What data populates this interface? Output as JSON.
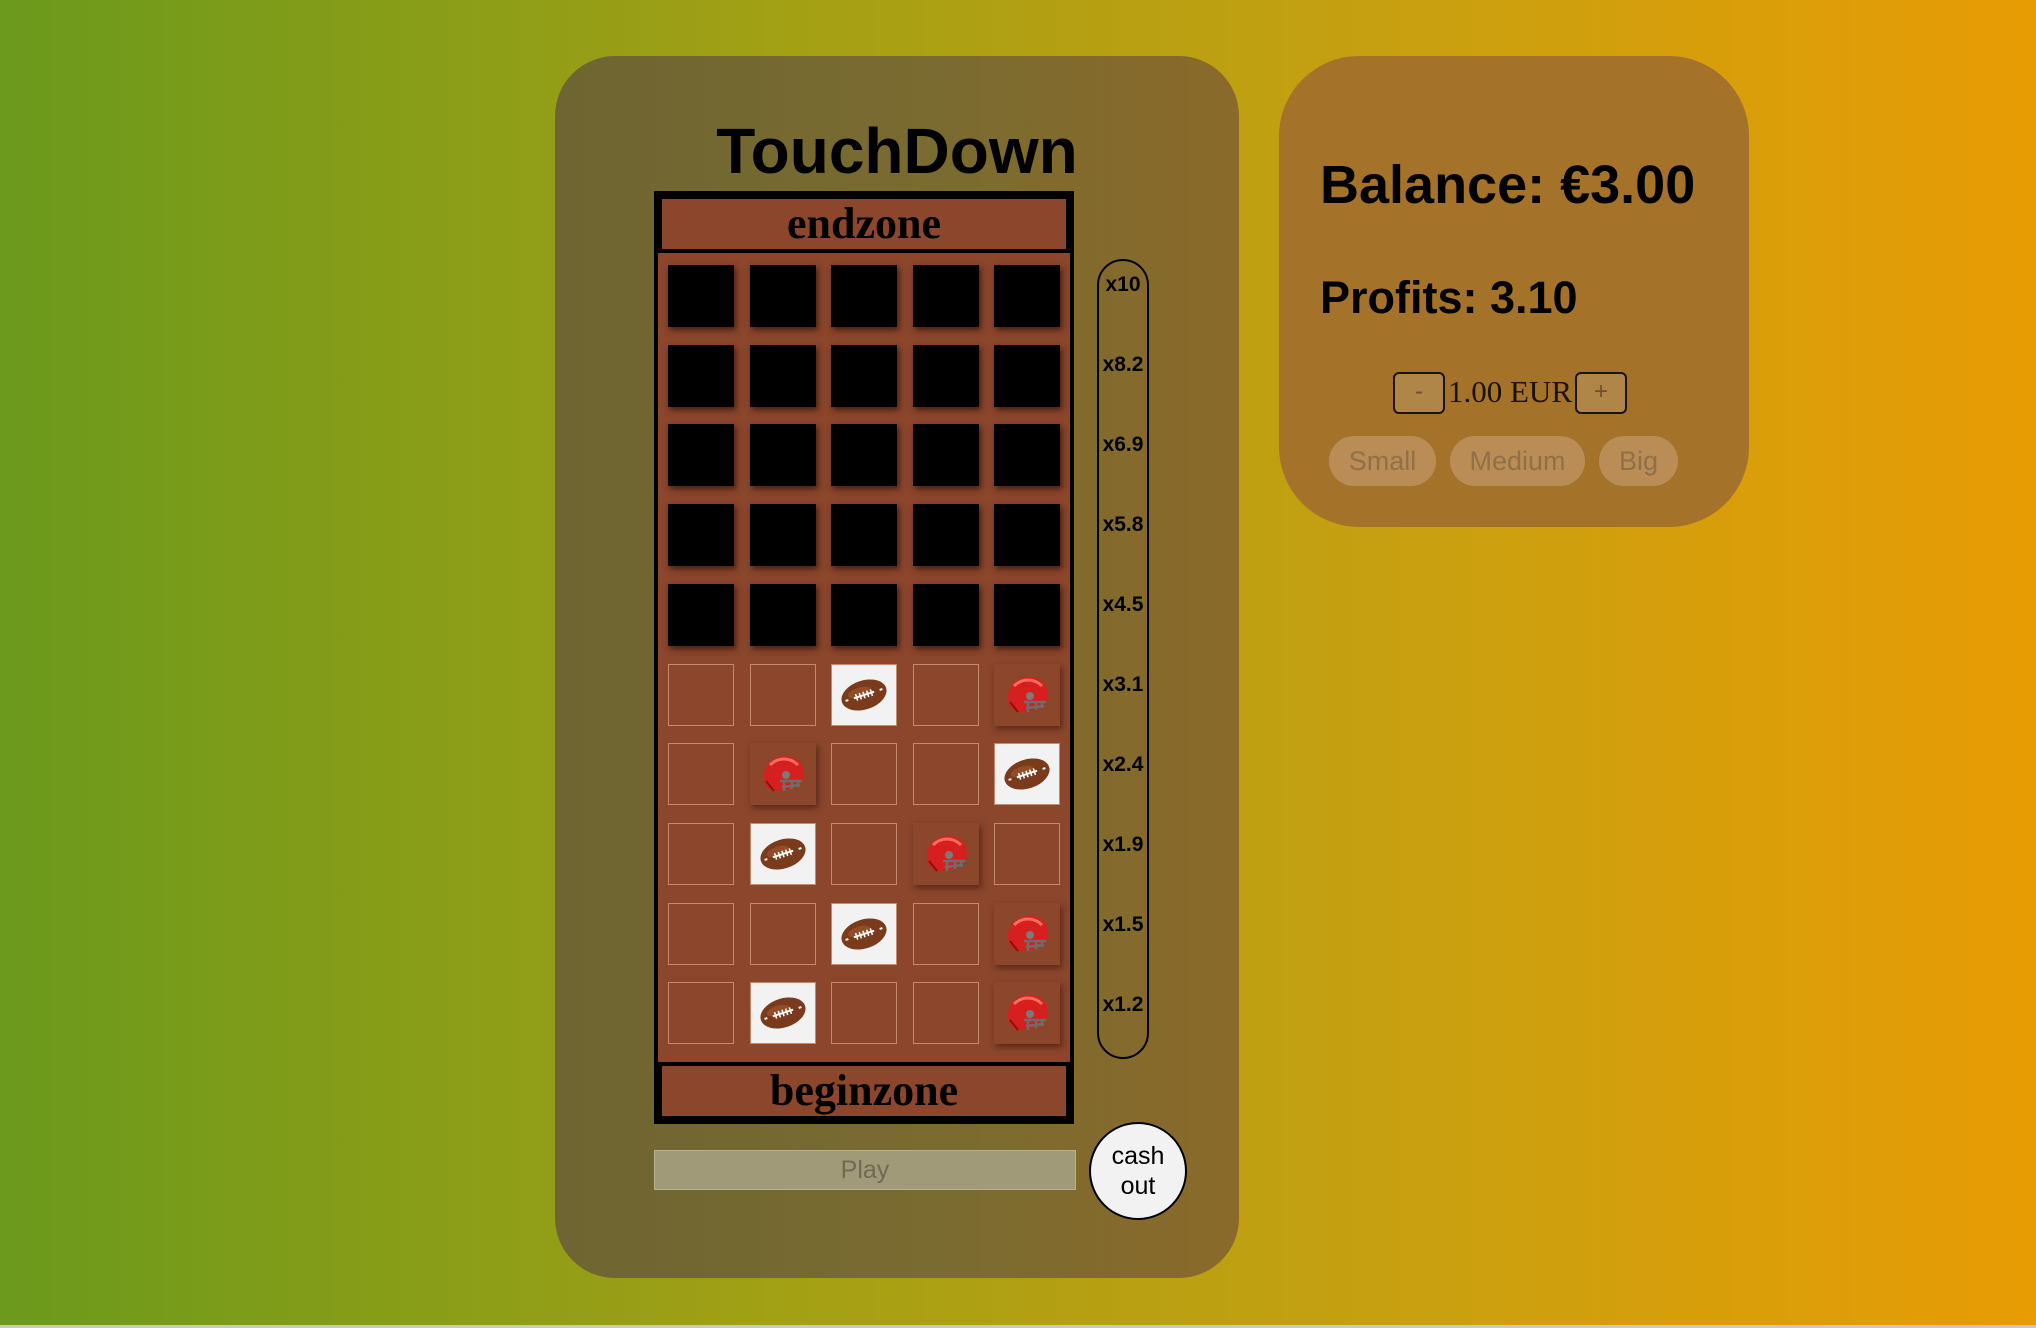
{
  "game": {
    "title": "TouchDown",
    "endzone_label": "endzone",
    "beginzone_label": "beginzone",
    "multipliers": [
      "x10",
      "x8.2",
      "x6.9",
      "x5.8",
      "x4.5",
      "x3.1",
      "x2.4",
      "x1.9",
      "x1.5",
      "x1.2"
    ],
    "board_rows_top_to_bottom": [
      [
        "hidden",
        "hidden",
        "hidden",
        "hidden",
        "hidden"
      ],
      [
        "hidden",
        "hidden",
        "hidden",
        "hidden",
        "hidden"
      ],
      [
        "hidden",
        "hidden",
        "hidden",
        "hidden",
        "hidden"
      ],
      [
        "hidden",
        "hidden",
        "hidden",
        "hidden",
        "hidden"
      ],
      [
        "hidden",
        "hidden",
        "hidden",
        "hidden",
        "hidden"
      ],
      [
        "empty",
        "empty",
        "football",
        "empty",
        "helmet"
      ],
      [
        "empty",
        "helmet",
        "empty",
        "empty",
        "football"
      ],
      [
        "empty",
        "football",
        "empty",
        "helmet",
        "empty"
      ],
      [
        "empty",
        "empty",
        "football",
        "empty",
        "helmet"
      ],
      [
        "empty",
        "football",
        "empty",
        "empty",
        "helmet"
      ]
    ],
    "play_label": "Play",
    "cashout_label": "cash out"
  },
  "wallet": {
    "balance_text": "Balance: €3.00",
    "profits_text": "Profits: 3.10",
    "minus_label": "-",
    "plus_label": "+",
    "bet_text": "1.00 EUR",
    "presets": [
      "Small",
      "Medium",
      "Big"
    ]
  },
  "icons": {
    "football": "football-icon",
    "helmet": "helmet-icon"
  }
}
